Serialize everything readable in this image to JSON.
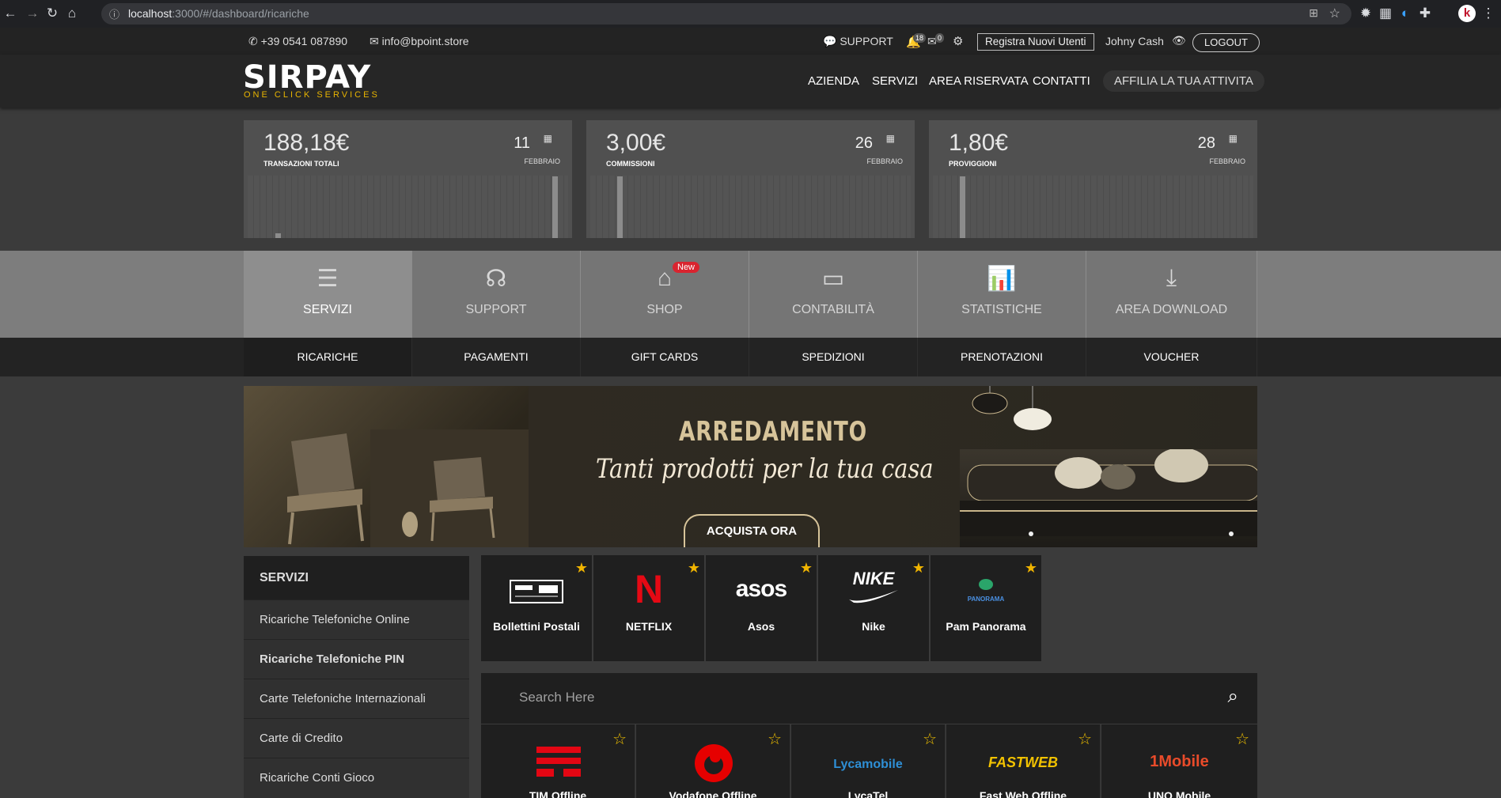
{
  "browser": {
    "url_host": "localhost",
    "url_rest": ":3000/#/dashboard/ricariche"
  },
  "topbar": {
    "phone": "+39 0541 087890",
    "email": "info@bpoint.store",
    "support": "SUPPORT",
    "notif_count": "18",
    "msg_count": "0",
    "register": "Registra Nuovi Utenti",
    "user": "Johny Cash",
    "logout": "LOGOUT"
  },
  "header": {
    "logo": "SIRPAY",
    "tagline": "ONE CLICK SERVICES",
    "nav": [
      "AZIENDA",
      "SERVIZI",
      "AREA RISERVATA",
      "CONTATTI"
    ],
    "affilia": "AFFILIA LA TUA ATTIVITA"
  },
  "stats": [
    {
      "value": "188,18€",
      "label": "TRANSAZIONI TOTALI",
      "day": "11",
      "month": "FEBBRAIO",
      "bars": [
        0.04,
        0.55
      ]
    },
    {
      "value": "3,00€",
      "label": "COMMISSIONI",
      "day": "26",
      "month": "FEBBRAIO",
      "bars": [
        0.55
      ]
    },
    {
      "value": "1,80€",
      "label": "PROVIGGIONI",
      "day": "28",
      "month": "FEBBRAIO",
      "bars": [
        0.55
      ]
    }
  ],
  "tabs": [
    {
      "label": "SERVIZI",
      "icon": "list-icon",
      "active": true
    },
    {
      "label": "SUPPORT",
      "icon": "headset-icon"
    },
    {
      "label": "SHOP",
      "icon": "shop-icon",
      "badge": "New"
    },
    {
      "label": "CONTABILITÀ",
      "icon": "wallet-icon"
    },
    {
      "label": "STATISTICHE",
      "icon": "chart-icon"
    },
    {
      "label": "AREA DOWNLOAD",
      "icon": "download-icon"
    }
  ],
  "subtabs": [
    "RICARICHE",
    "PAGAMENTI",
    "GIFT CARDS",
    "SPEDIZIONI",
    "PRENOTAZIONI",
    "VOUCHER"
  ],
  "banner": {
    "title": "ARREDAMENTO",
    "subtitle": "Tanti prodotti per la tua casa",
    "button": "ACQUISTA ORA"
  },
  "sidebar": {
    "title": "SERVIZI",
    "items": [
      "Ricariche Telefoniche Online",
      "Ricariche Telefoniche PIN",
      "Carte Telefoniche Internazionali",
      "Carte di Credito",
      "Ricariche Conti Gioco"
    ]
  },
  "favorites": [
    {
      "label": "Bollettini Postali",
      "logo": "bollettini-logo"
    },
    {
      "label": "NETFLIX",
      "logo": "N"
    },
    {
      "label": "Asos",
      "logo": "asos"
    },
    {
      "label": "Nike",
      "logo": "NIKE"
    },
    {
      "label": "Pam Panorama",
      "logo": "PANORAMA"
    }
  ],
  "search": {
    "placeholder": "Search Here"
  },
  "operators": [
    {
      "label": "TIM Offline",
      "logo": "TIM"
    },
    {
      "label": "Vodafone Offline",
      "logo": "vodafone"
    },
    {
      "label": "LycaTel",
      "logo": "Lycamobile"
    },
    {
      "label": "Fast Web Offline",
      "logo": "FASTWEB"
    },
    {
      "label": "UNO Mobile",
      "logo": "1Mobile"
    }
  ],
  "colors": {
    "accent": "#e8b400",
    "star": "#f0b400",
    "netflix": "#e50914",
    "tim": "#e30613",
    "vodafone": "#e60000",
    "newbadge": "#d9242f"
  }
}
